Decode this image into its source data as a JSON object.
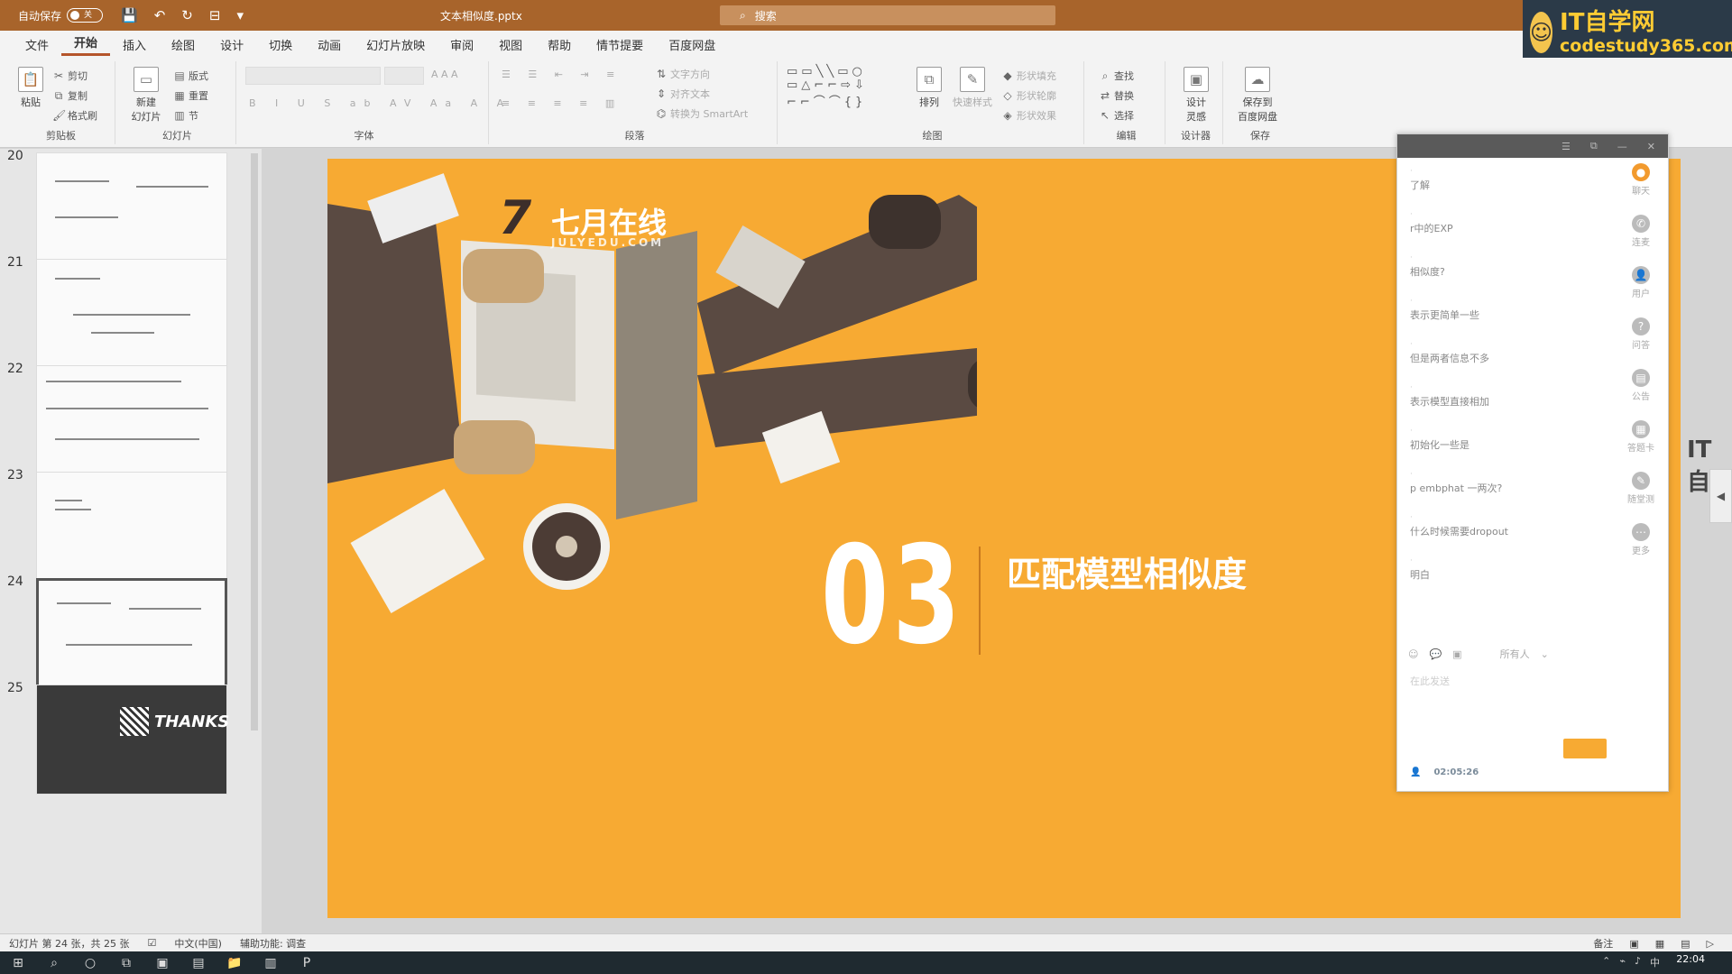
{
  "titlebar": {
    "autosave_label": "自动保存",
    "autosave_state": "关",
    "filename": "文本相似度.pptx",
    "search_placeholder": "搜索"
  },
  "brand": {
    "title": "IT自学网",
    "url": "codestudy365.com"
  },
  "menu": [
    "文件",
    "开始",
    "插入",
    "绘图",
    "设计",
    "切换",
    "动画",
    "幻灯片放映",
    "审阅",
    "视图",
    "帮助",
    "情节提要",
    "百度网盘"
  ],
  "menu_active": "开始",
  "ribbon": {
    "clipboard": {
      "label": "剪贴板",
      "paste": "粘贴",
      "cut": "剪切",
      "copy": "复制",
      "format_painter": "格式刷"
    },
    "slides": {
      "label": "幻灯片",
      "new_slide": "新建\n幻灯片",
      "layout": "版式",
      "reset": "重置",
      "section": "节"
    },
    "font": {
      "label": "字体"
    },
    "paragraph": {
      "label": "段落",
      "text_direction": "文字方向",
      "align_text": "对齐文本",
      "smartart": "转换为 SmartArt"
    },
    "drawing": {
      "label": "绘图",
      "arrange": "排列",
      "quick_styles": "快速样式",
      "shape_fill": "形状填充",
      "shape_outline": "形状轮廓",
      "shape_effects": "形状效果"
    },
    "editing": {
      "label": "编辑",
      "find": "查找",
      "replace": "替换",
      "select": "选择"
    },
    "designer": {
      "label": "设计器",
      "design_ideas": "设计\n灵感"
    },
    "save": {
      "label": "保存",
      "save_to_baidu": "保存到\n百度网盘"
    }
  },
  "thumbnails": [
    {
      "num": "20"
    },
    {
      "num": "21"
    },
    {
      "num": "22"
    },
    {
      "num": "23"
    },
    {
      "num": "24"
    },
    {
      "num": "25",
      "text": "THANKS"
    }
  ],
  "slide": {
    "logo_name": "七月在线",
    "logo_sub": "JULYEDU.COM",
    "number": "03",
    "title": "匹配模型相似度"
  },
  "chat": {
    "messages": [
      {
        "text": "了解"
      },
      {
        "text": "r中的EXP"
      },
      {
        "text": "相似度?"
      },
      {
        "text": "表示更简单一些"
      },
      {
        "text": "但是两者信息不多"
      },
      {
        "text": "表示模型直接相加"
      },
      {
        "text": "初始化一些是"
      },
      {
        "text": "p embphat 一两次?"
      },
      {
        "text": "什么时候需要dropout"
      },
      {
        "text": "明白"
      }
    ],
    "side": [
      "聊天",
      "连麦",
      "用户",
      "问答",
      "公告",
      "答题卡",
      "随堂测",
      "更多"
    ],
    "recipient": "所有人",
    "input_placeholder": "在此发送",
    "elapsed": "02:05:26"
  },
  "side_tab": "IT自",
  "statusbar": {
    "slide_info": "幻灯片 第 24 张，共 25 张",
    "language": "中文(中国)",
    "accessibility": "辅助功能: 调查",
    "notes": "备注"
  },
  "taskbar": {
    "clock": "22:04",
    "ime": "中"
  },
  "colors": {
    "slide_bg": "#f7aa33",
    "titlebar": "#a8642b",
    "brand_bg": "#2b3a48",
    "brand_text": "#ffcc33"
  }
}
